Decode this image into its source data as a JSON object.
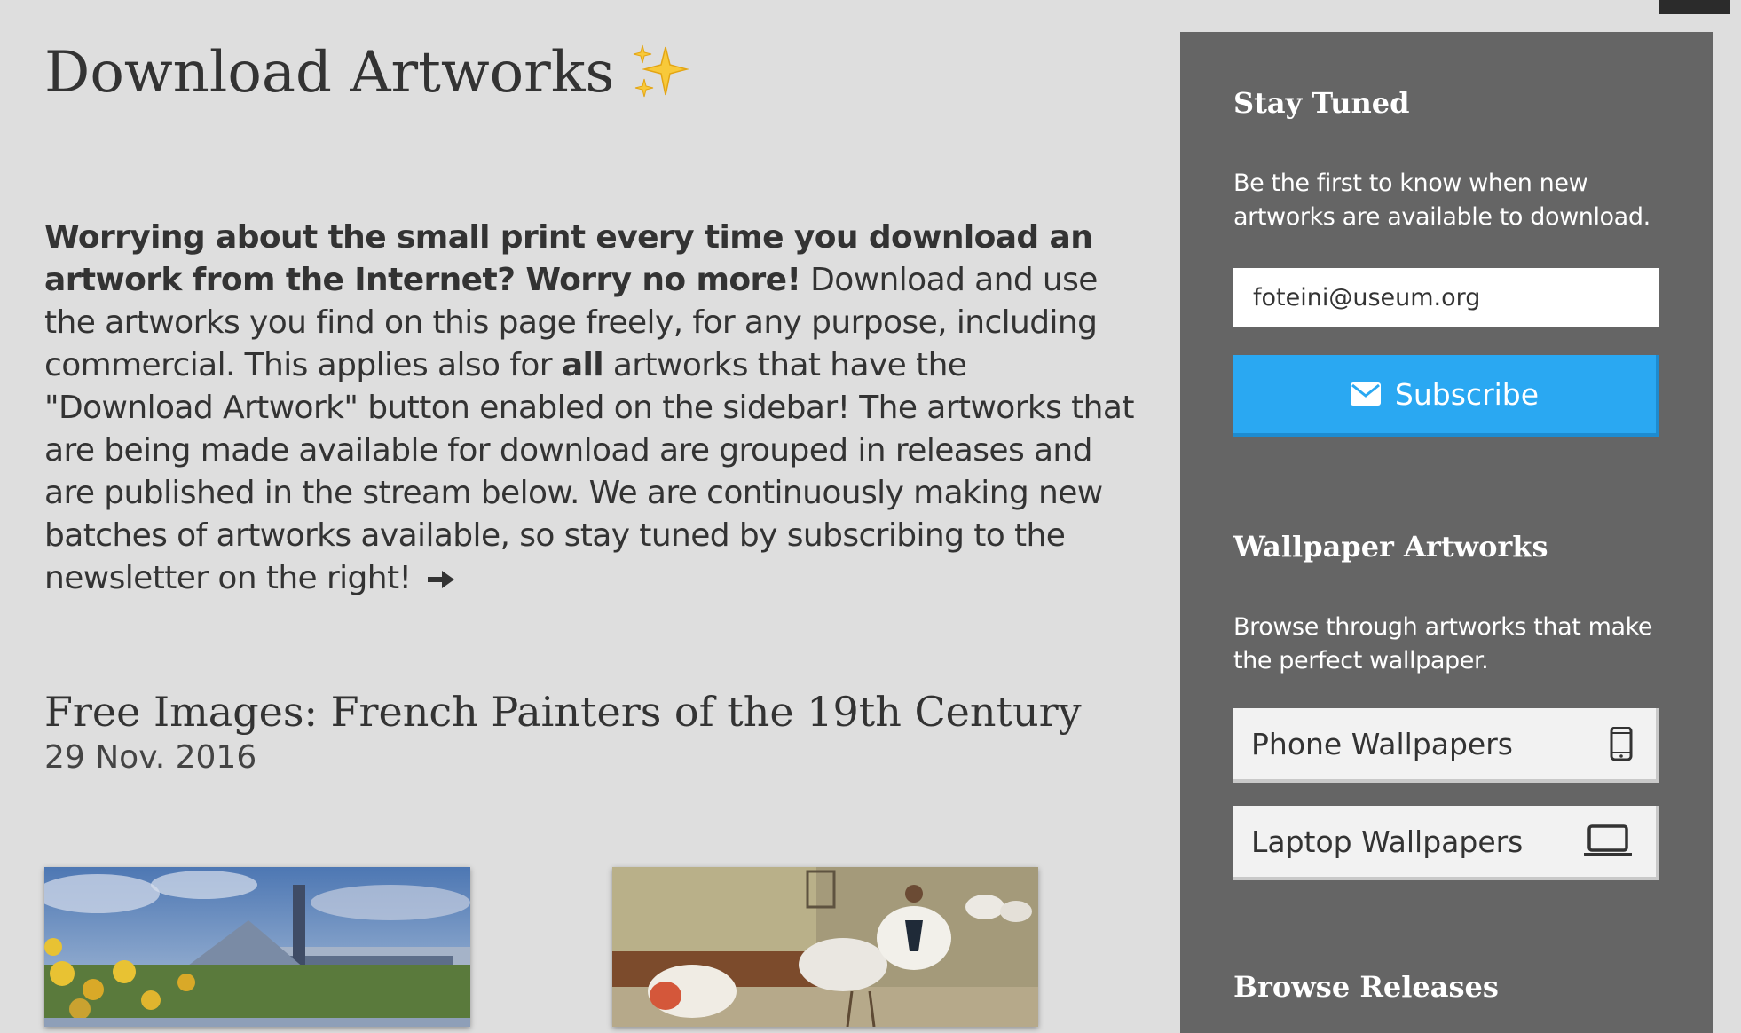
{
  "page": {
    "title": "Download Artworks",
    "intro_bold": "Worrying about the small print every time you download an artwork from the Internet? Worry no more!",
    "intro_part1": " Download and use the artworks you find on this page freely, for any purpose, including commercial. This applies also for ",
    "intro_bold2": "all",
    "intro_part2": " artworks that have the \"Download Artwork\" button enabled on the sidebar! The artworks that are being made available for download are grouped in releases and are published in the stream below.  We are continuously making new batches of artworks available, so stay tuned by subscribing to the newsletter on the right! "
  },
  "release": {
    "title": "Free Images: French Painters of the 19th Century",
    "date": "29 Nov. 2016"
  },
  "sidebar": {
    "stay_tuned": {
      "heading": "Stay Tuned",
      "text": "Be the first to know when new artworks are available to download.",
      "email_value": "foteini@useum.org",
      "subscribe_label": "Subscribe"
    },
    "wallpapers": {
      "heading": "Wallpaper Artworks",
      "text": "Browse through artworks that make the perfect wallpaper.",
      "phone_label": "Phone Wallpapers",
      "laptop_label": "Laptop Wallpapers"
    },
    "browse": {
      "heading": "Browse Releases"
    }
  },
  "colors": {
    "background": "#dedede",
    "sidebar": "#656565",
    "accent": "#2aa8f2"
  },
  "icons": [
    "sparkles-icon",
    "arrow-right-icon",
    "envelope-icon",
    "phone-icon",
    "laptop-icon"
  ]
}
